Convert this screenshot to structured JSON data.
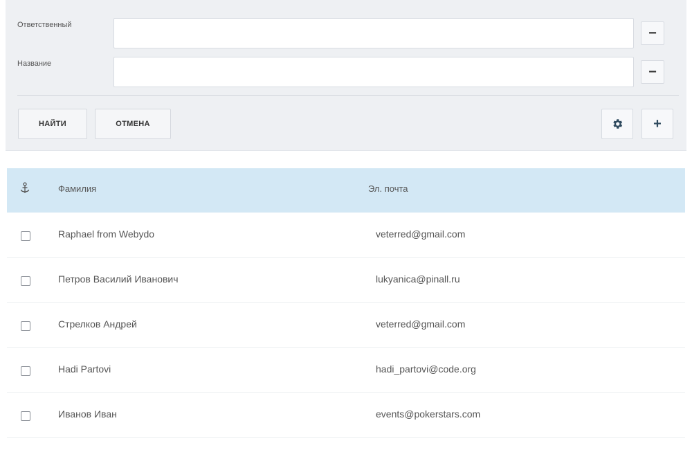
{
  "filters": [
    {
      "label": "Ответственный",
      "value": "",
      "remove_icon": "minus-icon"
    },
    {
      "label": "Название",
      "value": "",
      "remove_icon": "minus-icon"
    }
  ],
  "actions": {
    "find_label": "НАЙТИ",
    "cancel_label": "ОТМЕНА",
    "settings_icon": "gear-icon",
    "add_icon": "plus-icon"
  },
  "table": {
    "header_icon": "anchor-icon",
    "columns": [
      "Фамилия",
      "Эл. почта"
    ],
    "rows": [
      {
        "name": "Raphael from Webydo",
        "email": "veterred@gmail.com",
        "checked": false
      },
      {
        "name": "Петров Василий Иванович",
        "email": "lukyanica@pinall.ru",
        "checked": false
      },
      {
        "name": "Стрелков Андрей",
        "email": "veterred@gmail.com",
        "checked": false
      },
      {
        "name": "Hadi Partovi",
        "email": "hadi_partovi@code.org",
        "checked": false
      },
      {
        "name": "Иванов Иван",
        "email": "events@pokerstars.com",
        "checked": false
      }
    ]
  },
  "colors": {
    "panel_bg": "#eef0f3",
    "header_bg": "#d3e8f5",
    "accent_icon": "#2f4a5e"
  }
}
